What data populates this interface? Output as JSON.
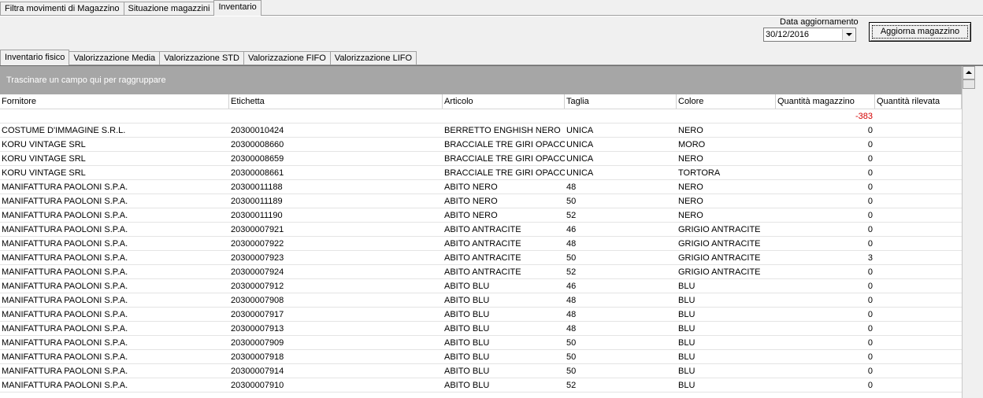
{
  "top_tabs": [
    "Filtra movimenti di Magazzino",
    "Situazione magazzini",
    "Inventario"
  ],
  "date_label": "Data aggiornamento",
  "date_value": "30/12/2016",
  "update_button": "Aggiorna magazzino",
  "sub_tabs": [
    "Inventario fisico",
    "Valorizzazione Media",
    "Valorizzazione STD",
    "Valorizzazione FIFO",
    "Valorizzazione LIFO"
  ],
  "group_panel": "Trascinare un campo qui per raggruppare",
  "columns": [
    "Fornitore",
    "Etichetta",
    "Articolo",
    "Taglia",
    "Colore",
    "Quantità magazzino",
    "Quantità rilevata"
  ],
  "total_quantita": "-383",
  "rows": [
    [
      "COSTUME D'IMMAGINE S.R.L.",
      "20300010424",
      "BERRETTO ENGHISH NERO",
      "UNICA",
      "NERO",
      "0",
      ""
    ],
    [
      "KORU VINTAGE SRL",
      "20300008660",
      "BRACCIALE TRE GIRI OPACO",
      "UNICA",
      "MORO",
      "0",
      ""
    ],
    [
      "KORU VINTAGE SRL",
      "20300008659",
      "BRACCIALE TRE GIRI OPACO",
      "UNICA",
      "NERO",
      "0",
      ""
    ],
    [
      "KORU VINTAGE SRL",
      "20300008661",
      "BRACCIALE TRE GIRI OPACO",
      "UNICA",
      "TORTORA",
      "0",
      ""
    ],
    [
      "MANIFATTURA PAOLONI S.P.A.",
      "20300011188",
      "ABITO  NERO",
      "48",
      "NERO",
      "0",
      ""
    ],
    [
      "MANIFATTURA PAOLONI S.P.A.",
      "20300011189",
      "ABITO  NERO",
      "50",
      "NERO",
      "0",
      ""
    ],
    [
      "MANIFATTURA PAOLONI S.P.A.",
      "20300011190",
      "ABITO  NERO",
      "52",
      "NERO",
      "0",
      ""
    ],
    [
      "MANIFATTURA PAOLONI S.P.A.",
      "20300007921",
      "ABITO ANTRACITE",
      "46",
      "GRIGIO ANTRACITE",
      "0",
      ""
    ],
    [
      "MANIFATTURA PAOLONI S.P.A.",
      "20300007922",
      "ABITO ANTRACITE",
      "48",
      "GRIGIO ANTRACITE",
      "0",
      ""
    ],
    [
      "MANIFATTURA PAOLONI S.P.A.",
      "20300007923",
      "ABITO ANTRACITE",
      "50",
      "GRIGIO ANTRACITE",
      "3",
      ""
    ],
    [
      "MANIFATTURA PAOLONI S.P.A.",
      "20300007924",
      "ABITO ANTRACITE",
      "52",
      "GRIGIO ANTRACITE",
      "0",
      ""
    ],
    [
      "MANIFATTURA PAOLONI S.P.A.",
      "20300007912",
      "ABITO BLU",
      "46",
      "BLU",
      "0",
      ""
    ],
    [
      "MANIFATTURA PAOLONI S.P.A.",
      "20300007908",
      "ABITO BLU",
      "48",
      "BLU",
      "0",
      ""
    ],
    [
      "MANIFATTURA PAOLONI S.P.A.",
      "20300007917",
      "ABITO BLU",
      "48",
      "BLU",
      "0",
      ""
    ],
    [
      "MANIFATTURA PAOLONI S.P.A.",
      "20300007913",
      "ABITO BLU",
      "48",
      "BLU",
      "0",
      ""
    ],
    [
      "MANIFATTURA PAOLONI S.P.A.",
      "20300007909",
      "ABITO BLU",
      "50",
      "BLU",
      "0",
      ""
    ],
    [
      "MANIFATTURA PAOLONI S.P.A.",
      "20300007918",
      "ABITO BLU",
      "50",
      "BLU",
      "0",
      ""
    ],
    [
      "MANIFATTURA PAOLONI S.P.A.",
      "20300007914",
      "ABITO BLU",
      "50",
      "BLU",
      "0",
      ""
    ],
    [
      "MANIFATTURA PAOLONI S.P.A.",
      "20300007910",
      "ABITO BLU",
      "52",
      "BLU",
      "0",
      ""
    ]
  ]
}
